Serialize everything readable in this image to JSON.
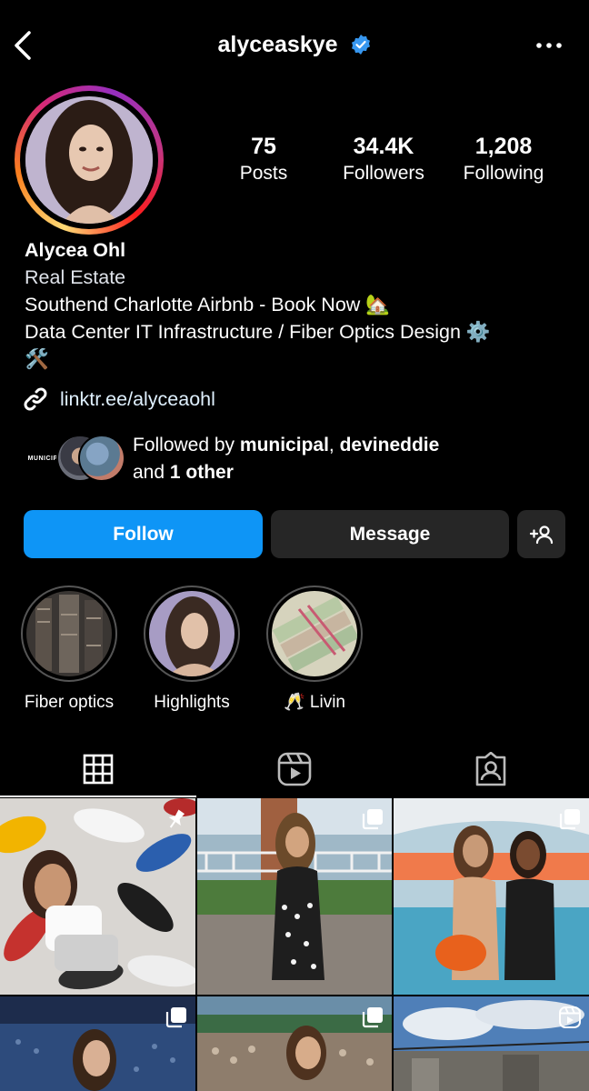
{
  "header": {
    "username": "alyceaskye",
    "back_icon": "chevron-left-icon",
    "verified_icon": "verified-badge-icon",
    "more_icon": "more-horizontal-icon"
  },
  "profile": {
    "stats": {
      "posts_count": "75",
      "posts_label": "Posts",
      "followers_count": "34.4K",
      "followers_label": "Followers",
      "following_count": "1,208",
      "following_label": "Following"
    },
    "name": "Alycea Ohl",
    "category": "Real Estate",
    "bio_line1": "Southend Charlotte Airbnb - Book Now 🏡",
    "bio_line2": "Data Center IT Infrastructure / Fiber Optics Design ⚙️",
    "bio_line3": "🛠️",
    "link": "linktr.ee/alyceaohl",
    "mutual": {
      "prefix": "Followed by ",
      "user1": "municipal",
      "sep": ", ",
      "user2": "devineddie",
      "line2_prefix": "and ",
      "others": "1 other",
      "avatar1_text": "MUNICIPAL"
    }
  },
  "actions": {
    "follow_label": "Follow",
    "message_label": "Message",
    "add_user_icon": "add-person-icon"
  },
  "highlights": [
    {
      "label": "Fiber optics"
    },
    {
      "label": "Highlights"
    },
    {
      "label": "🥂 Livin"
    }
  ],
  "tabs": [
    {
      "name": "posts-grid",
      "icon": "grid-icon",
      "active": true
    },
    {
      "name": "reels",
      "icon": "reels-icon",
      "active": false
    },
    {
      "name": "tagged",
      "icon": "tagged-person-icon",
      "active": false
    }
  ],
  "colors": {
    "follow_button": "#0e95f6",
    "secondary_button": "#262626",
    "verified": "#3797f0"
  }
}
